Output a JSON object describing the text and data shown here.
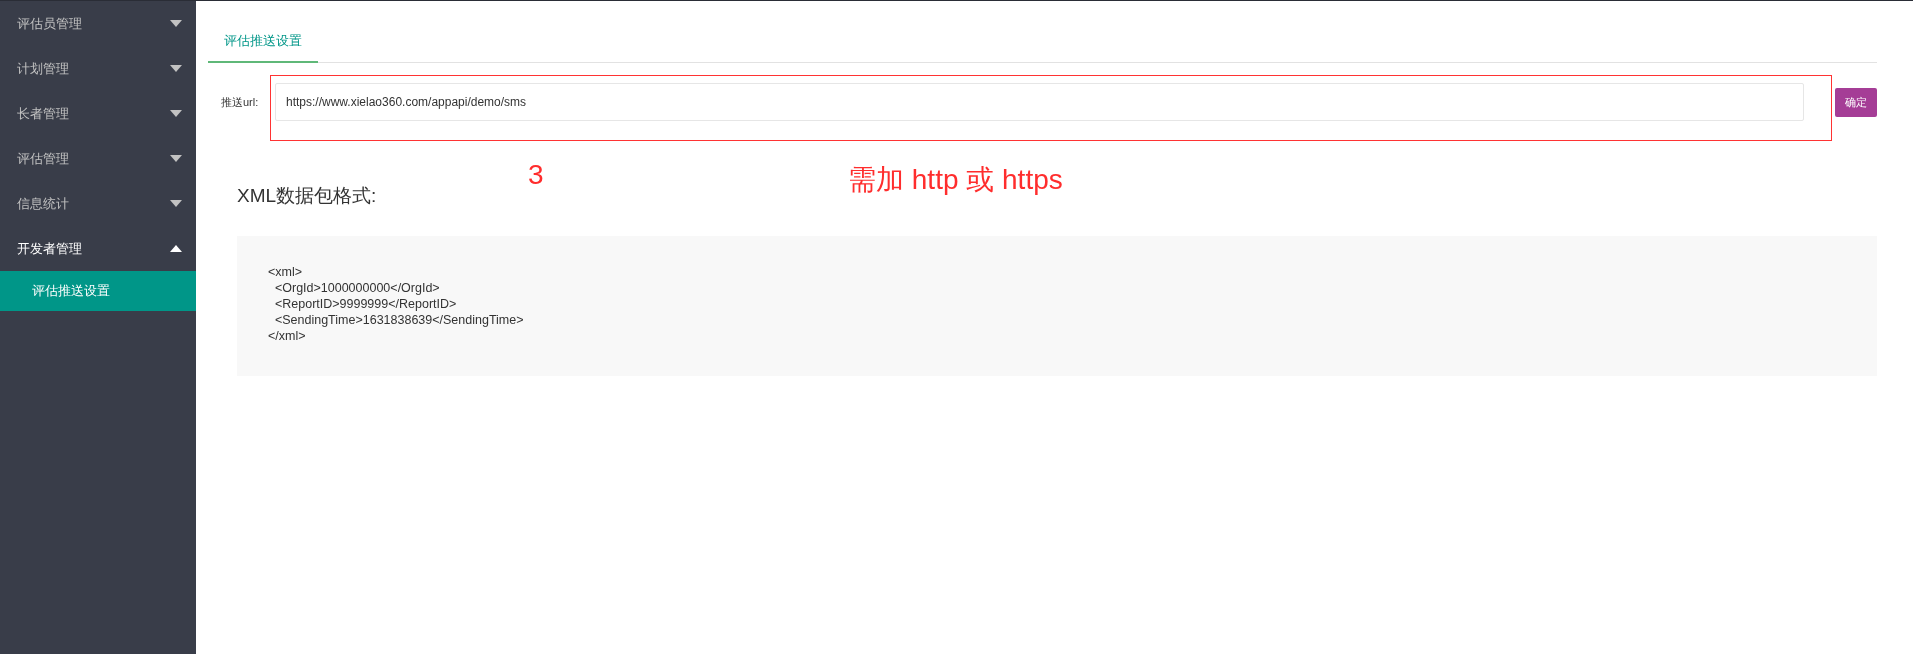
{
  "sidebar": {
    "items": [
      {
        "label": "评估员管理",
        "expanded": false
      },
      {
        "label": "计划管理",
        "expanded": false
      },
      {
        "label": "长者管理",
        "expanded": false
      },
      {
        "label": "评估管理",
        "expanded": false
      },
      {
        "label": "信息统计",
        "expanded": false
      },
      {
        "label": "开发者管理",
        "expanded": true,
        "children": [
          {
            "label": "评估推送设置",
            "selected": true
          }
        ]
      }
    ]
  },
  "tabs": [
    {
      "label": "评估推送设置",
      "selected": true
    }
  ],
  "form": {
    "label": "推送url:",
    "value": "https://www.xielao360.com/appapi/demo/sms",
    "button": "确定"
  },
  "annotations": {
    "number": "3",
    "note": "需加 http 或 https"
  },
  "xml_section": {
    "heading": "XML数据包格式:",
    "code_lines": [
      "<xml>",
      "  <OrgId>1000000000</OrgId>",
      "  <ReportID>9999999</ReportID>",
      "  <SendingTime>1631838639</SendingTime>",
      "</xml>"
    ]
  }
}
